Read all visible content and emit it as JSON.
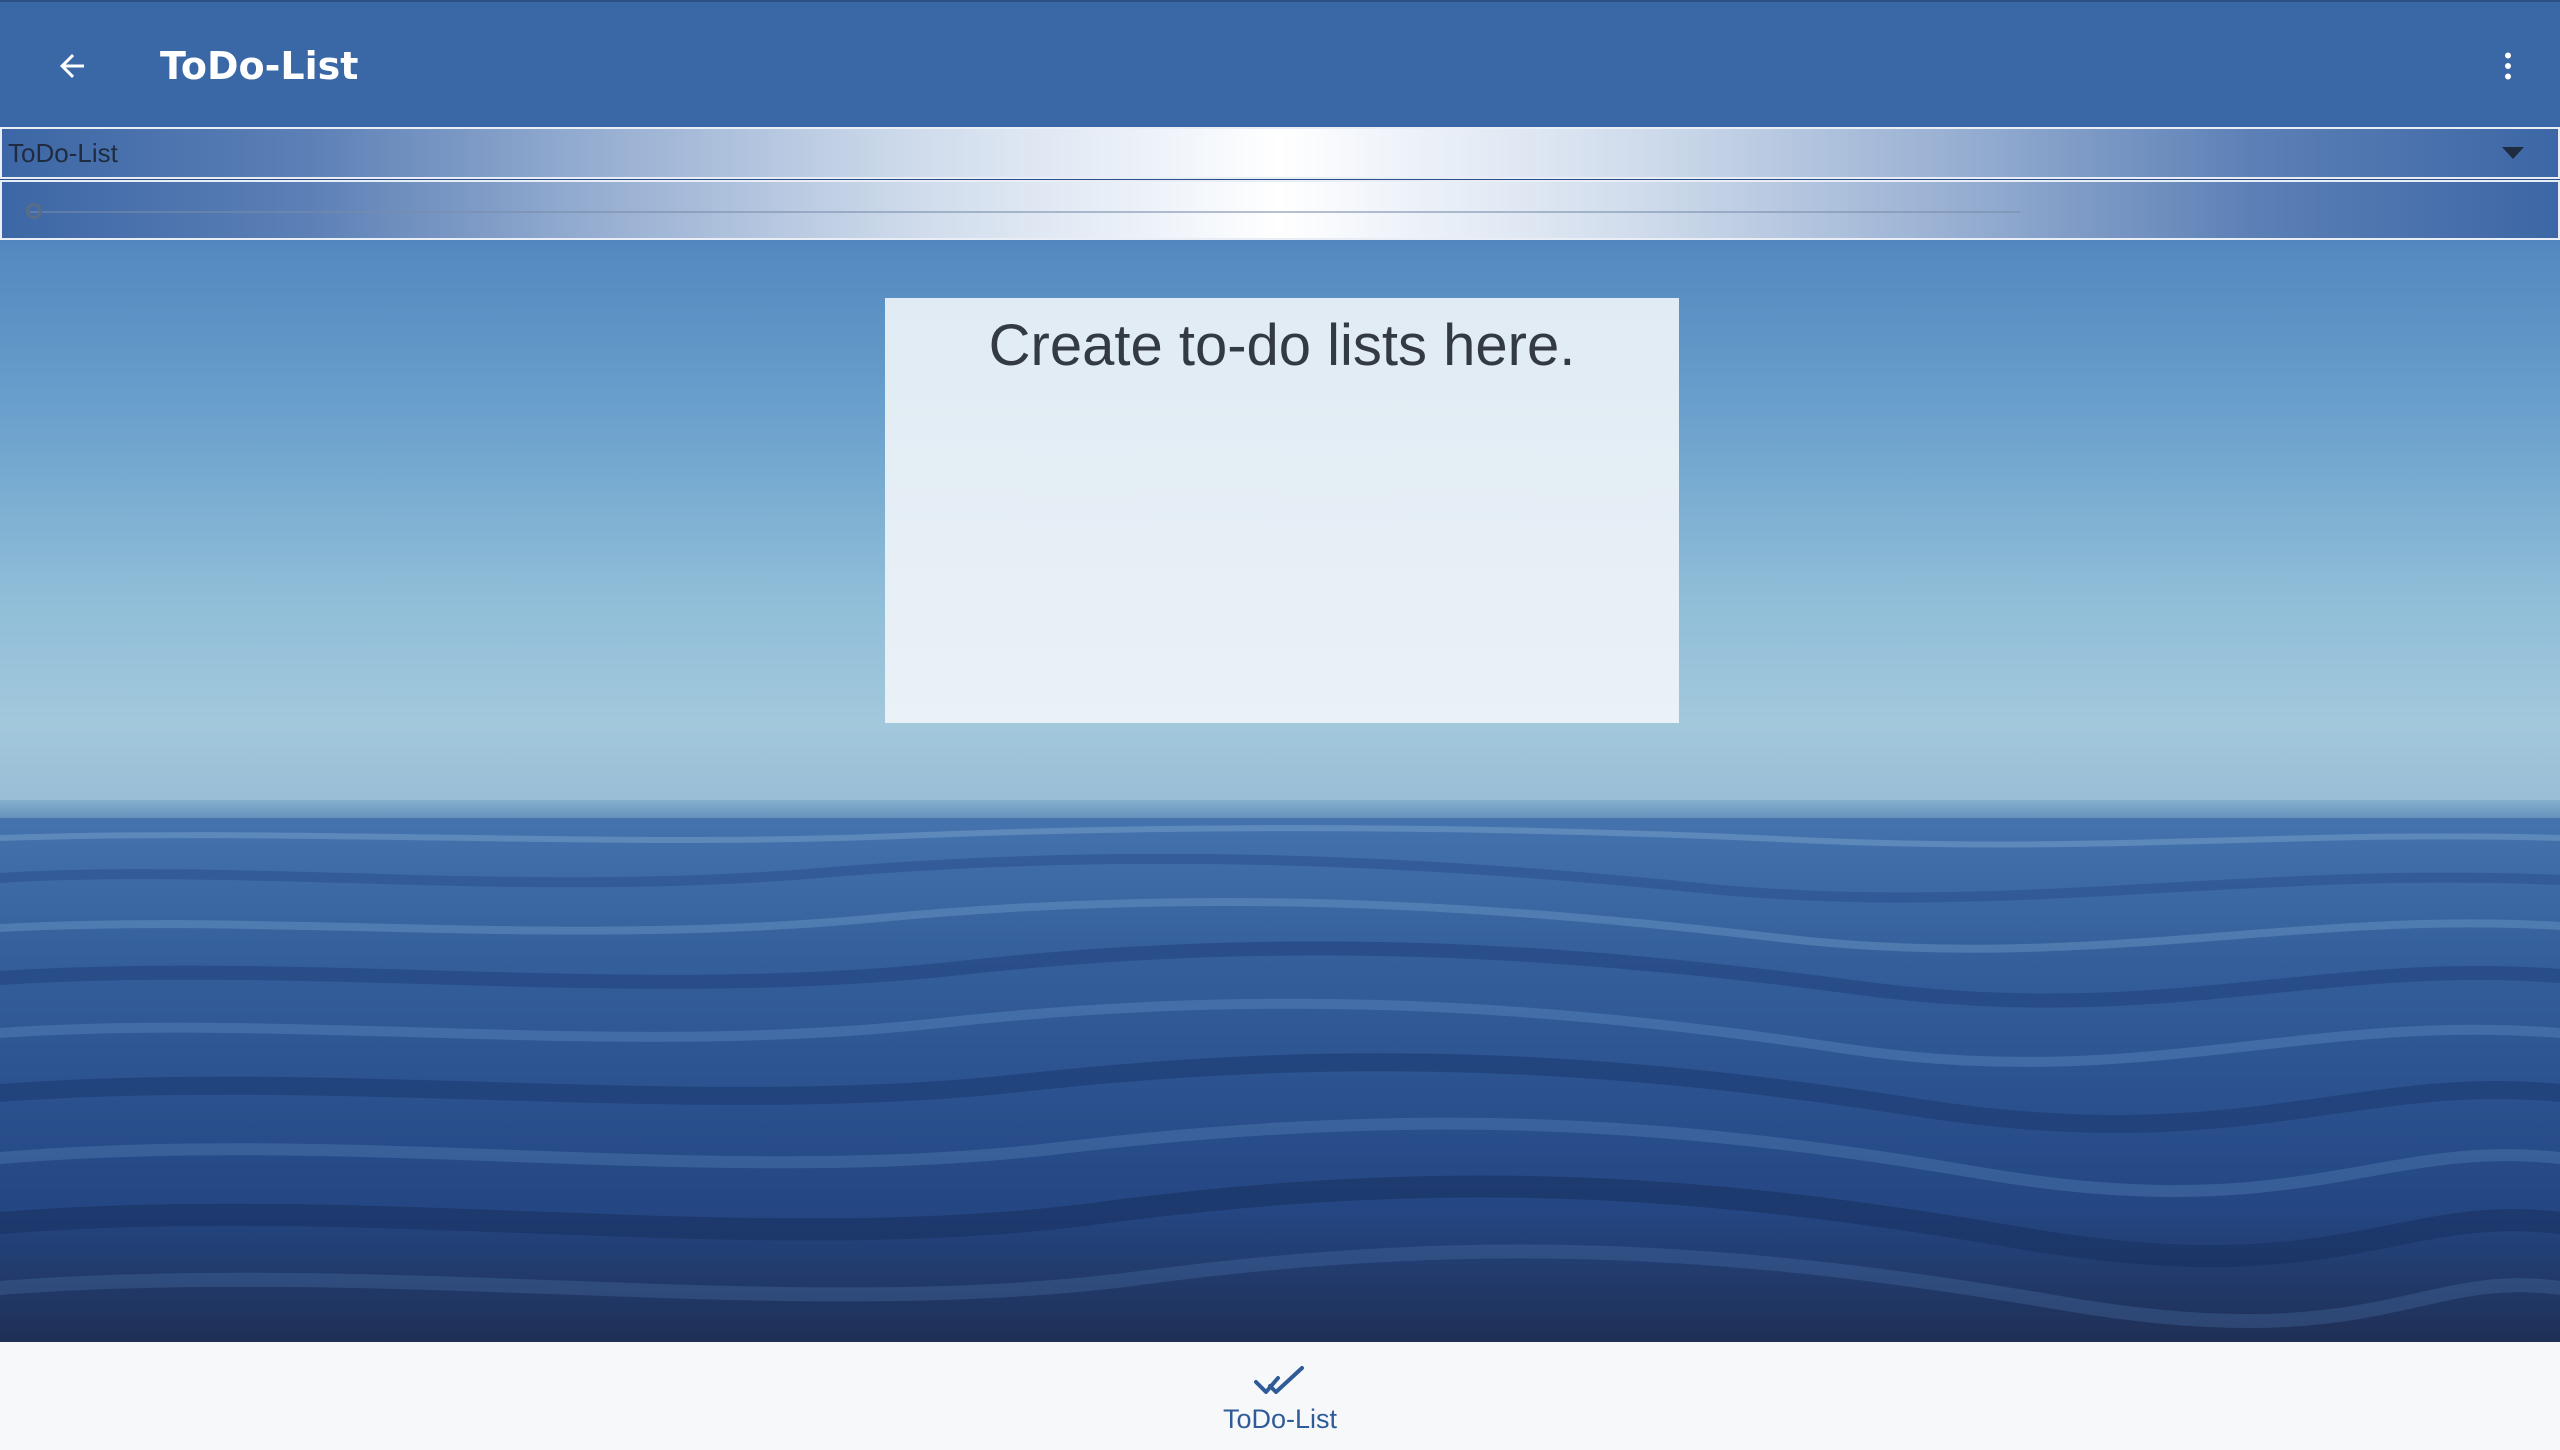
{
  "app": {
    "title": "ToDo-List",
    "accent_color": "#3a67a6"
  },
  "toolbar": {
    "back_icon": "arrow-left-icon",
    "overflow_icon": "more-vert-icon"
  },
  "list_selector": {
    "selected_value": "ToDo-List",
    "caret_icon": "caret-down-icon"
  },
  "slider": {
    "value": 0
  },
  "card": {
    "message": "Create to-do lists here."
  },
  "bottom_nav": {
    "items": [
      {
        "label": "ToDo-List",
        "icon": "double-check-icon"
      }
    ]
  }
}
